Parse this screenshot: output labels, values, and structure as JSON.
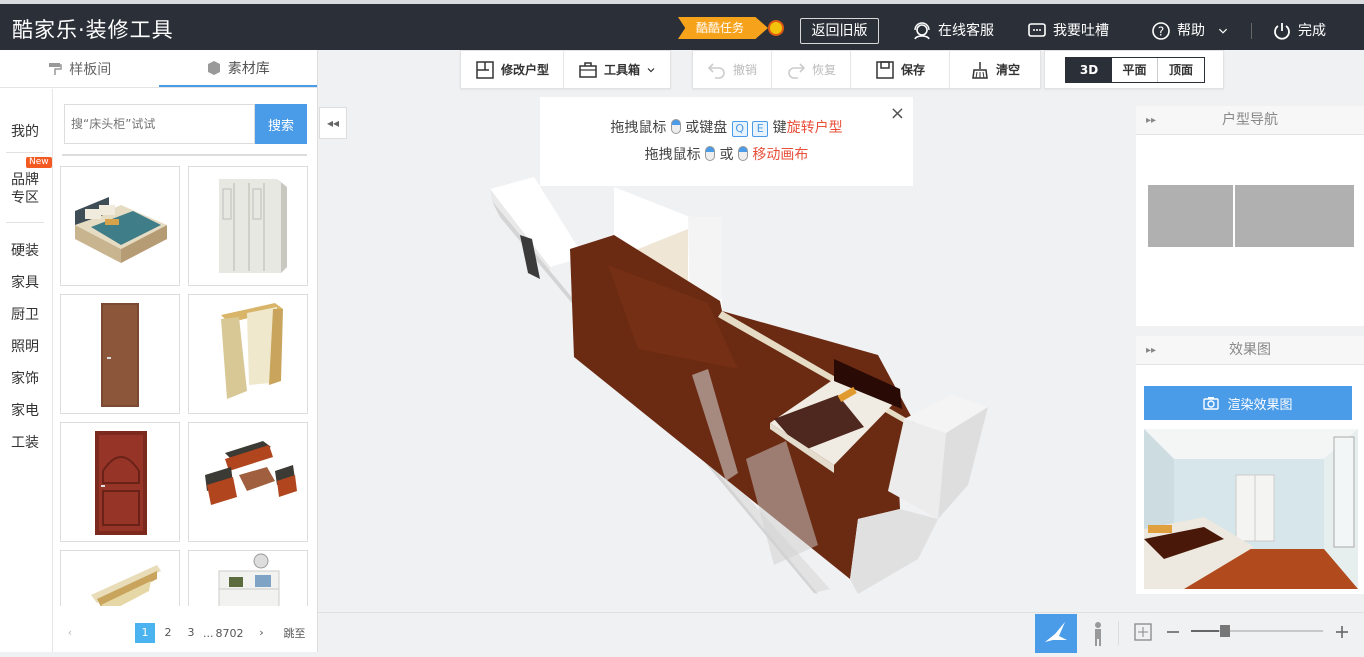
{
  "header": {
    "logo": "酷家乐·装修工具",
    "task_badge": "酷酷任务",
    "back_old": "返回旧版",
    "service": "在线客服",
    "feedback": "我要吐槽",
    "help": "帮助",
    "done": "完成"
  },
  "left": {
    "tabs": [
      "样板间",
      "素材库"
    ],
    "categories": {
      "mine": "我的",
      "brand": "品牌专区",
      "new_badge": "New",
      "items": [
        "硬装",
        "家具",
        "厨卫",
        "照明",
        "家饰",
        "家电",
        "工装"
      ]
    },
    "search": {
      "placeholder": "搜“床头柜”试试",
      "button": "搜索"
    },
    "pager": {
      "prev": "‹",
      "pages": [
        "1",
        "2",
        "3"
      ],
      "ellipsis": "...",
      "last": "8702",
      "next": "›",
      "jump": "跳至"
    }
  },
  "toolbar": {
    "edit_layout": "修改户型",
    "toolbox": "工具箱",
    "undo": "撤销",
    "redo": "恢复",
    "save": "保存",
    "clear": "清空",
    "views": [
      "3D",
      "平面",
      "顶面"
    ]
  },
  "hint": {
    "line1_a": "拖拽鼠标",
    "line1_b": "或键盘",
    "key_q": "Q",
    "key_e": "E",
    "line1_c": "键",
    "line1_d": "旋转户型",
    "line2_a": "拖拽鼠标",
    "line2_b": "或",
    "line2_c": "移动画布",
    "close": "×"
  },
  "right": {
    "nav_title": "户型导航",
    "render_title": "效果图",
    "render_button": "渲染效果图"
  },
  "colors": {
    "accent": "#4a9be8",
    "header_bg": "#2b3038",
    "task": "#f7a21b",
    "floor": "#6b2a12"
  }
}
